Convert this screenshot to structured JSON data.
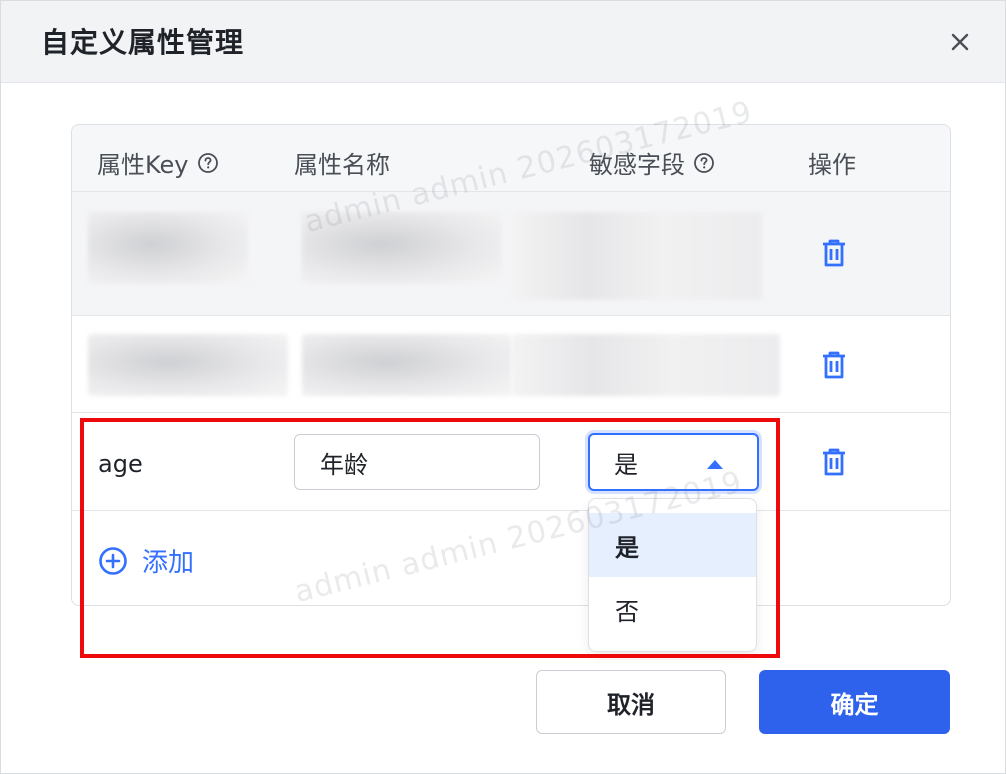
{
  "dialog": {
    "title": "自定义属性管理",
    "close_icon": "close-icon"
  },
  "table": {
    "headers": {
      "key": "属性Key",
      "name": "属性名称",
      "sensitive": "敏感字段",
      "action": "操作"
    },
    "help_icon": "question-circle-icon",
    "delete_icon": "trash-icon",
    "editing_row": {
      "key": "age",
      "name_value": "年龄",
      "sensitive_value": "是"
    },
    "add_label": "添加",
    "add_icon": "plus-circle-icon"
  },
  "dropdown": {
    "options": [
      "是",
      "否"
    ],
    "selected": "是"
  },
  "footer": {
    "cancel_label": "取消",
    "ok_label": "确定"
  },
  "watermark": "admin admin 202603172019",
  "colors": {
    "primary": "#2f62ec",
    "accent": "#3370ff",
    "highlight_border": "#ee0a0a",
    "header_bg": "#f2f3f5"
  }
}
